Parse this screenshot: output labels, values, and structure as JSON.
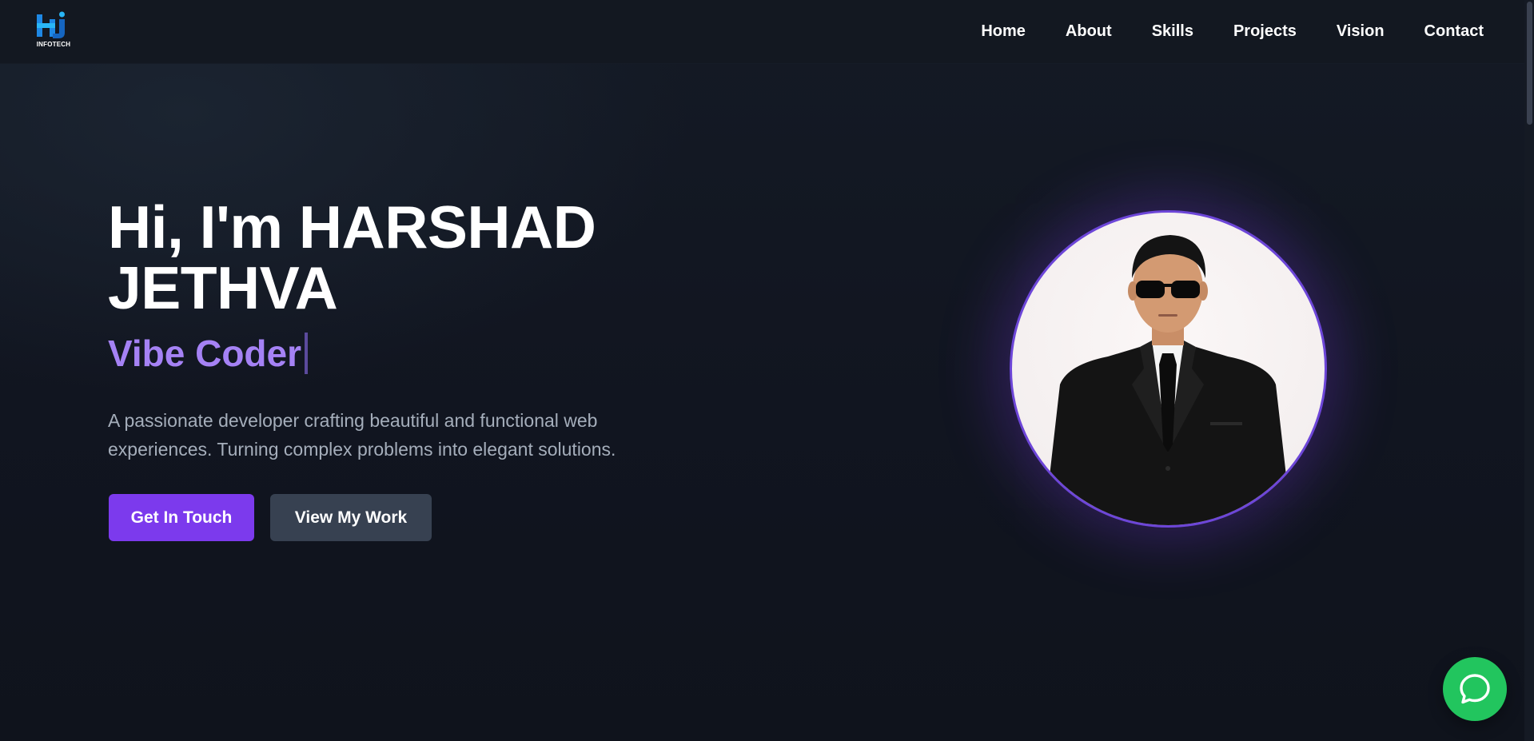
{
  "header": {
    "logo_text": "INFOTECH",
    "logo_letters": "HJ",
    "nav": [
      {
        "label": "Home"
      },
      {
        "label": "About"
      },
      {
        "label": "Skills"
      },
      {
        "label": "Projects"
      },
      {
        "label": "Vision"
      },
      {
        "label": "Contact"
      }
    ]
  },
  "hero": {
    "title_line1": "Hi, I'm HARSHAD",
    "title_line2": "JETHVA",
    "subtitle": "Vibe Coder",
    "description": "A passionate developer crafting beautiful and functional web experiences. Turning complex problems into elegant solutions.",
    "primary_button": "Get In Touch",
    "secondary_button": "View My Work"
  },
  "colors": {
    "accent": "#7c3aed",
    "subtitle": "#a582f5",
    "secondary_button": "#374151",
    "background": "#111520",
    "chat": "#22c55e"
  },
  "icons": {
    "logo": "hj-infotech-logo",
    "chat": "chat-bubble-icon"
  }
}
